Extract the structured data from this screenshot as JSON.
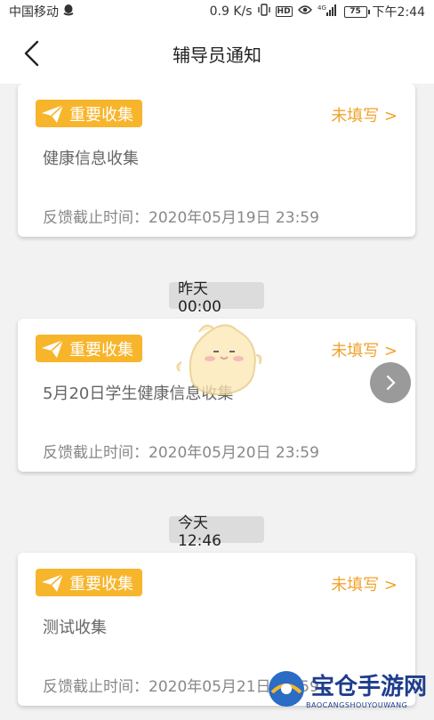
{
  "statusbar": {
    "carrier": "中国移动",
    "speed": "0.9 K/s",
    "network": "4G",
    "battery": "75",
    "time": "下午2:44"
  },
  "navbar": {
    "title": "辅导员通知"
  },
  "timestamps": [
    "昨天 00:00",
    "今天 12:46"
  ],
  "cards": [
    {
      "tag": "重要收集",
      "status": "未填写 >",
      "name": "健康信息收集",
      "deadline": "反馈截止时间：2020年05月19日 23:59"
    },
    {
      "tag": "重要收集",
      "status": "未填写 >",
      "name": "5月20日学生健康信息收集",
      "deadline": "反馈截止时间：2020年05月20日 23:59"
    },
    {
      "tag": "重要收集",
      "status": "未填写 >",
      "name": "测试收集",
      "deadline": "反馈截止时间：2020年05月21日 23:59"
    }
  ],
  "watermark": {
    "text": "宝仓手游网",
    "sub": "BAOCANGSHOUYOUWANG"
  },
  "colors": {
    "accent": "#f7b52c",
    "status": "#f0a32c",
    "background": "#f2f2f2"
  }
}
